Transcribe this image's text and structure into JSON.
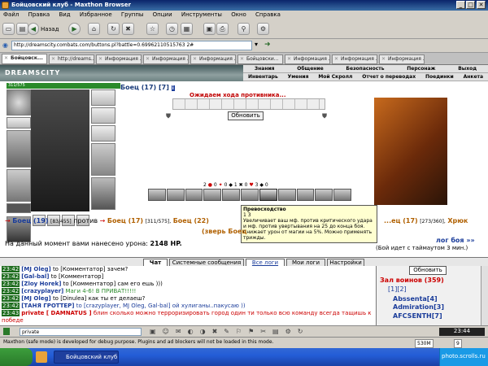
{
  "window": {
    "title": "Бойцовский клуб - Maxthon Browser"
  },
  "menu": [
    "Файл",
    "Правка",
    "Вид",
    "Избранное",
    "Группы",
    "Опции",
    "Инструменты",
    "Окно",
    "Справка"
  ],
  "toolbar": {
    "back_label": "Назад"
  },
  "address": {
    "url": "http://dreamscity.combats.com/buttons.pl?battle=0.69962110515763 2#"
  },
  "tabs": [
    "Бойцовск...",
    "http://dreams...",
    "Информация ...",
    "Информация ...",
    "Информация ...",
    "Бойцовски...",
    "Информация ...",
    "Информация ...",
    "Информация ..."
  ],
  "game": {
    "logo": "DREAMSCITY",
    "toplinks_row1": [
      "Знания",
      "Общение",
      "Безопасность",
      "Персонаж",
      "Выход"
    ],
    "toplinks_row2": [
      "Инвентарь",
      "Умения",
      "Мой Скролл",
      "Отчет о переводах",
      "Поединки",
      "Анкета"
    ]
  },
  "player": {
    "hp_text": "311/575",
    "name": "Боец (17) [7]"
  },
  "battle": {
    "wait_text": "Ожидаем хода противника...",
    "refresh_label": "Обновить",
    "stats_row": [
      "2",
      "0",
      "0",
      "1",
      "0",
      "3",
      "0",
      "1"
    ]
  },
  "tooltip": {
    "title": "Превосходство",
    "line1": "1  3",
    "text": "Увеличивает ваш мф. против критического удара и мф. против увертывания на 25 до конца боя. Снижает урон от магии на 5%. Можно применять трижды."
  },
  "strip": {
    "line1_a": "Боец (19)",
    "line1_b": "[83/455]",
    "vs": "против",
    "line1_c": "Боец (17)",
    "line1_d": "[311/575],",
    "line1_e": "Боец (22)",
    "line1_f": "...ец (17)",
    "line1_g": "[273/360],",
    "line1_h": "Хрюк",
    "line2": "(зверь Боец"
  },
  "damage": {
    "text": "На данный момент вами нанесено урона:",
    "value": "2148 HP."
  },
  "log_link": "лог боя »»",
  "timeout": "(Бой идет с таймаутом 3 мин.)",
  "chat_tabs": [
    "Чат",
    "Системные сообщения",
    "Все логи",
    "Мои логи",
    "Настройки"
  ],
  "chat": [
    {
      "t": "23:42",
      "who": "[MJ Oleg]",
      "rest": "to [Комментатор] зачем?"
    },
    {
      "t": "23:42",
      "who": "[Gal-bal]",
      "rest": "to [Комментатор]"
    },
    {
      "t": "23:42",
      "who": "[Zloy Horek]",
      "rest": "to [Комментатор] сам его ешь )))"
    },
    {
      "t": "23:42",
      "who": "[crazyplayer]",
      "rest": "Маги 4-6! В ПРИВАТ!!!!!"
    },
    {
      "t": "23:42",
      "who": "[MJ Oleg]",
      "rest": "to [Dinulea] как ты ет делаеш?"
    },
    {
      "t": "23:42",
      "who": "[ТАНЯ ГРОТТЕР]",
      "rest": "to [crazyplayer, MJ Oleg, Gal-bal] ой хулиганы..пакусаю ))"
    },
    {
      "t": "23:43",
      "who": "private [ DAMNATUS ]",
      "rest": "блин сколько можно терроризировать город один ти только всю команду всегда тащишь к победе"
    }
  ],
  "right_panel": {
    "refresh_label": "Обновить",
    "room_title": "Зал воинов (359)",
    "pages": [
      "[1]",
      "[2]"
    ],
    "players": [
      "Abssenta[4]",
      "Admiration[3]",
      "AFCSENTH[7]"
    ]
  },
  "input": {
    "value": "private"
  },
  "status": {
    "text": "Maxthon (safe mode) is developed for debug purpose. Plugins and ad blockers will not be loaded in this mode.",
    "memory": "530M",
    "count": "9"
  },
  "taskbar": {
    "app": "Бойцовский клуб - M...",
    "clock": "23:44",
    "watermark": "photo.scrolls.ru"
  }
}
